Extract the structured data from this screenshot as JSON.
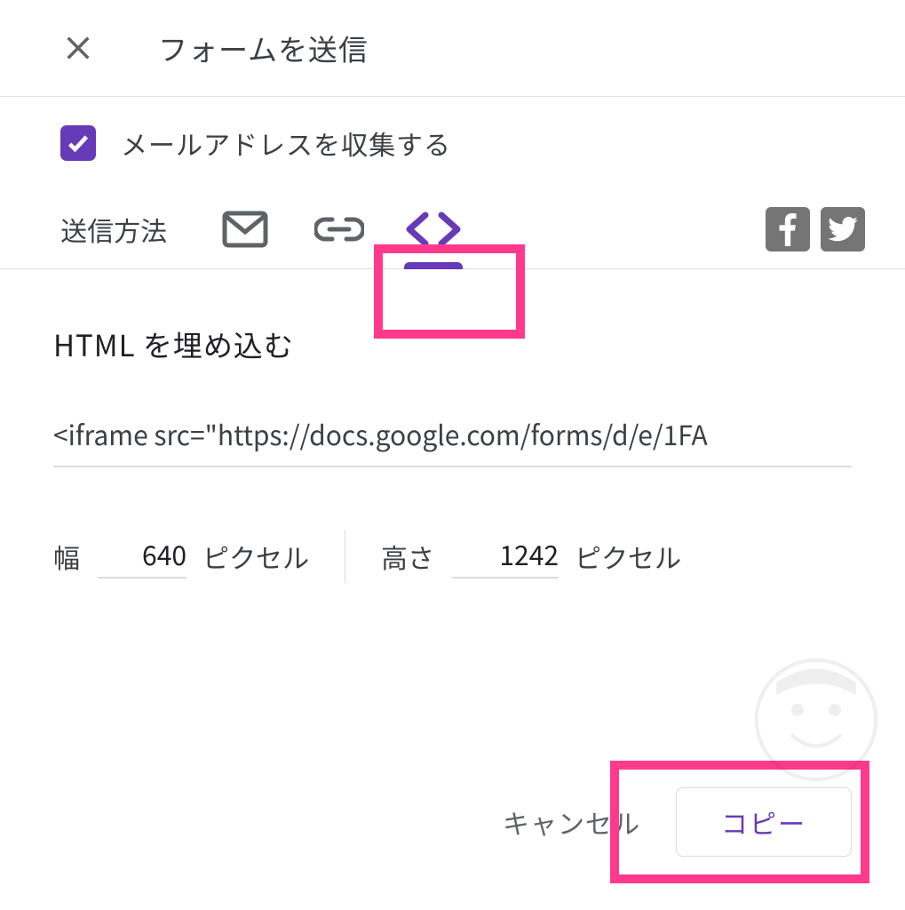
{
  "colors": {
    "accent": "#673ab7",
    "highlight": "#ff3a8c",
    "text": "#3c4043",
    "icon": "#5f6368"
  },
  "header": {
    "title": "フォームを送信"
  },
  "collect": {
    "checked": true,
    "label": "メールアドレスを収集する"
  },
  "tabs": {
    "label": "送信方法",
    "items": [
      {
        "name": "email-icon",
        "active": false
      },
      {
        "name": "link-icon",
        "active": false
      },
      {
        "name": "embed-icon",
        "active": true
      }
    ]
  },
  "social": {
    "facebook": "facebook-icon",
    "twitter": "twitter-icon"
  },
  "embed": {
    "heading": "HTML を埋め込む",
    "iframe_src": "<iframe src=\"https://docs.google.com/forms/d/e/1FA",
    "width": {
      "label": "幅",
      "value": "640",
      "unit": "ピクセル"
    },
    "height": {
      "label": "高さ",
      "value": "1242",
      "unit": "ピクセル"
    }
  },
  "footer": {
    "cancel": "キャンセル",
    "copy": "コピー"
  }
}
